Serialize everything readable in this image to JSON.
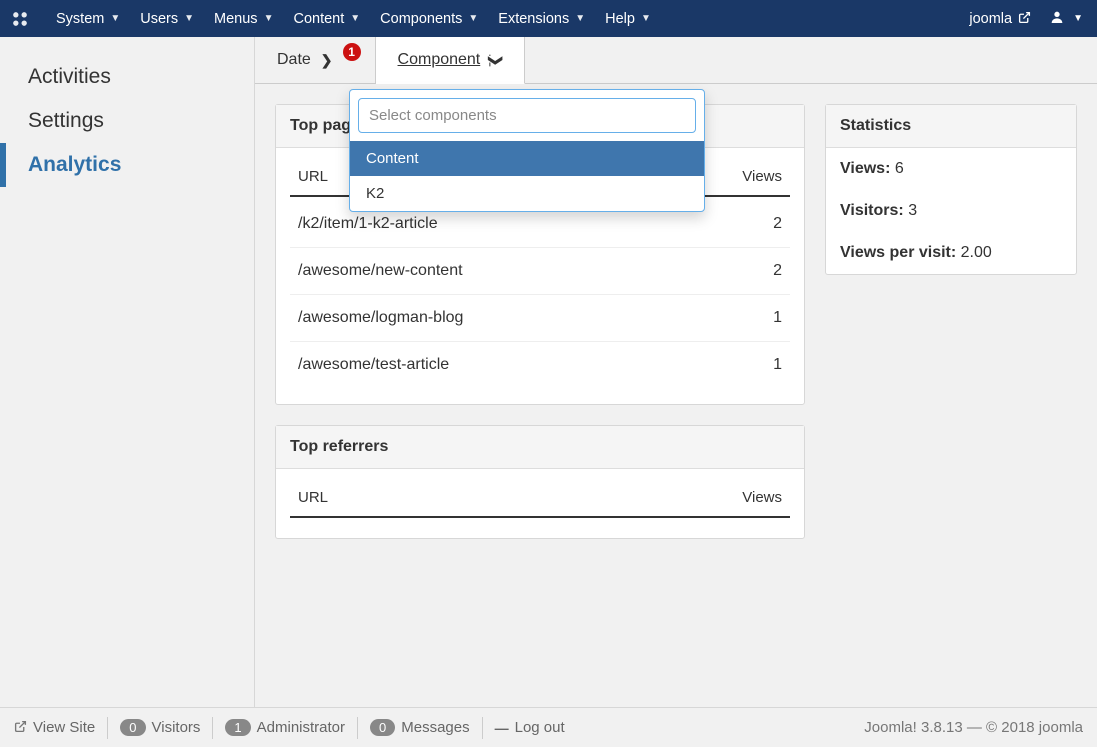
{
  "topnav": {
    "items": [
      "System",
      "Users",
      "Menus",
      "Content",
      "Components",
      "Extensions",
      "Help"
    ],
    "site": "joomla"
  },
  "sidebar": {
    "items": [
      "Activities",
      "Settings",
      "Analytics"
    ],
    "active_index": 2
  },
  "tabs": {
    "date": {
      "label": "Date",
      "badge": "1"
    },
    "component": {
      "label": "Component"
    }
  },
  "dropdown": {
    "placeholder": "Select components",
    "options": [
      "Content",
      "K2"
    ],
    "highlight_index": 0
  },
  "top_pages": {
    "title": "Top pages",
    "col_url": "URL",
    "col_views": "Views",
    "rows": [
      {
        "url": "/k2/item/1-k2-article",
        "views": "2"
      },
      {
        "url": "/awesome/new-content",
        "views": "2"
      },
      {
        "url": "/awesome/logman-blog",
        "views": "1"
      },
      {
        "url": "/awesome/test-article",
        "views": "1"
      }
    ]
  },
  "top_referrers": {
    "title": "Top referrers",
    "col_url": "URL",
    "col_views": "Views"
  },
  "stats": {
    "title": "Statistics",
    "views_label": "Views:",
    "views_value": "6",
    "visitors_label": "Visitors:",
    "visitors_value": "3",
    "vpv_label": "Views per visit:",
    "vpv_value": "2.00"
  },
  "footer": {
    "view_site": "View Site",
    "visitors_count": "0",
    "visitors_label": "Visitors",
    "admin_count": "1",
    "admin_label": "Administrator",
    "msg_count": "0",
    "msg_label": "Messages",
    "logout": "Log out",
    "version": "Joomla! 3.8.13",
    "sep": " — ",
    "copyright": "© 2018 joomla"
  }
}
